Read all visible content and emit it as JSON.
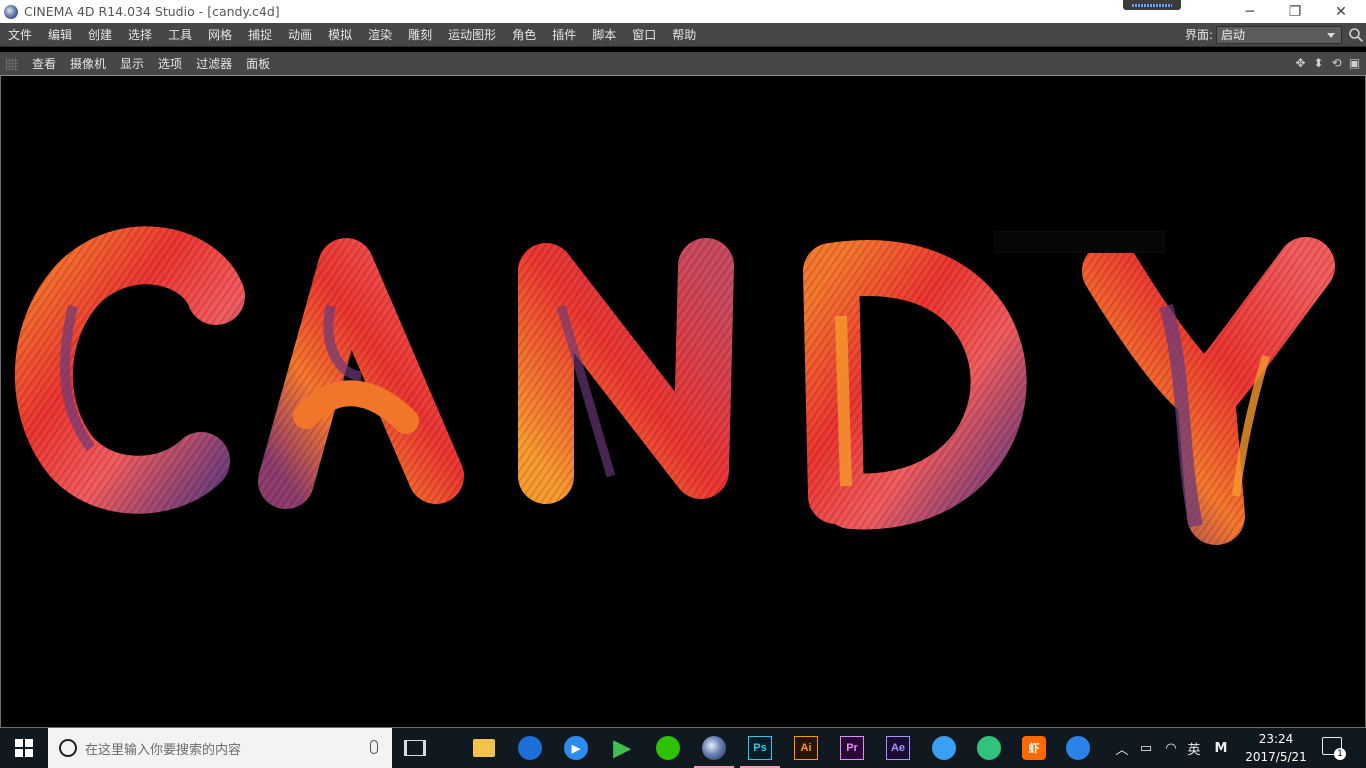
{
  "window": {
    "title": "CINEMA 4D R14.034 Studio - [candy.c4d]",
    "controls": {
      "minimize": "─",
      "maximize": "❐",
      "close": "✕"
    }
  },
  "menubar": {
    "items": [
      "文件",
      "编辑",
      "创建",
      "选择",
      "工具",
      "网格",
      "捕捉",
      "动画",
      "模拟",
      "渲染",
      "雕刻",
      "运动图形",
      "角色",
      "插件",
      "脚本",
      "窗口",
      "帮助"
    ],
    "layout_label": "界面:",
    "layout_value": "启动"
  },
  "viewport_toolbar": {
    "items": [
      "查看",
      "摄像机",
      "显示",
      "选项",
      "过滤器",
      "面板"
    ],
    "icons": [
      "move-view-icon",
      "zoom-view-icon",
      "rotate-view-icon",
      "maximize-view-icon"
    ]
  },
  "viewport": {
    "scene_text": "CANDY",
    "hud_text": "",
    "colors": {
      "background": "#000000",
      "red": "#e8322e",
      "orange": "#f2762a",
      "purple": "#6c3a78",
      "pink": "#ef5a5a"
    }
  },
  "taskbar": {
    "search_placeholder": "在这里输入你要搜索的内容",
    "apps": [
      {
        "name": "file-explorer",
        "label": ""
      },
      {
        "name": "qq-browser",
        "label": ""
      },
      {
        "name": "media-player",
        "label": ""
      },
      {
        "name": "video-app",
        "label": ""
      },
      {
        "name": "wechat",
        "label": ""
      },
      {
        "name": "cinema4d",
        "label": ""
      },
      {
        "name": "photoshop",
        "label": "Ps"
      },
      {
        "name": "illustrator",
        "label": "Ai"
      },
      {
        "name": "premiere",
        "label": "Pr"
      },
      {
        "name": "after-effects",
        "label": "Ae"
      },
      {
        "name": "baidu-netdisk",
        "label": ""
      },
      {
        "name": "qq-music",
        "label": ""
      },
      {
        "name": "xiami-music",
        "label": "虾"
      },
      {
        "name": "sogou-input",
        "label": ""
      }
    ],
    "tray": {
      "ime_label": "英",
      "mode_label": "M"
    },
    "time": "23:24",
    "date": "2017/5/21",
    "notification_count": "1"
  }
}
